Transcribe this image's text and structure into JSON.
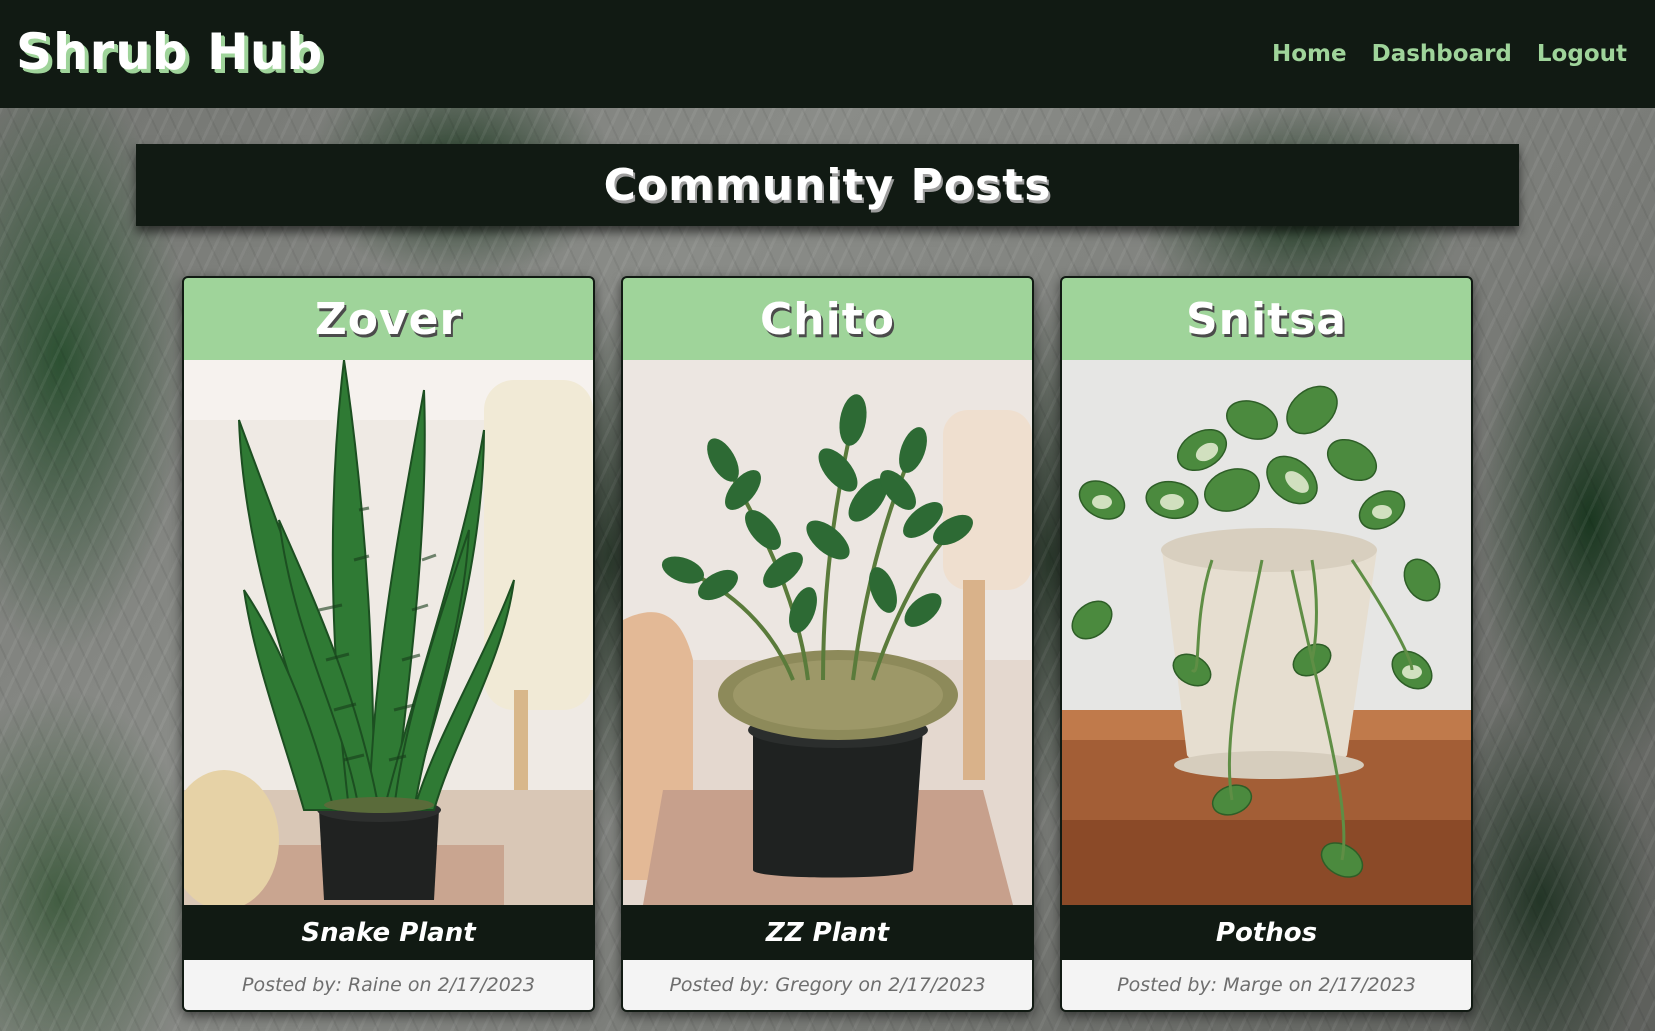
{
  "header": {
    "brand": "Shrub Hub",
    "nav": [
      {
        "label": "Home"
      },
      {
        "label": "Dashboard"
      },
      {
        "label": "Logout"
      }
    ]
  },
  "page": {
    "title": "Community Posts"
  },
  "posts": [
    {
      "name": "Zover",
      "plant": "Snake Plant",
      "meta": "Posted by: Raine on 2/17/2023",
      "image_icon": "snake-plant-photo"
    },
    {
      "name": "Chito",
      "plant": "ZZ Plant",
      "meta": "Posted by: Gregory on 2/17/2023",
      "image_icon": "zz-plant-photo"
    },
    {
      "name": "Snitsa",
      "plant": "Pothos",
      "meta": "Posted by: Marge on 2/17/2023",
      "image_icon": "pothos-photo"
    }
  ],
  "colors": {
    "header_bg": "#111a13",
    "accent_green": "#9fd49a",
    "text_light": "#ffffff",
    "meta_bg": "#f4f4f4",
    "meta_text": "#6e6e6e"
  }
}
